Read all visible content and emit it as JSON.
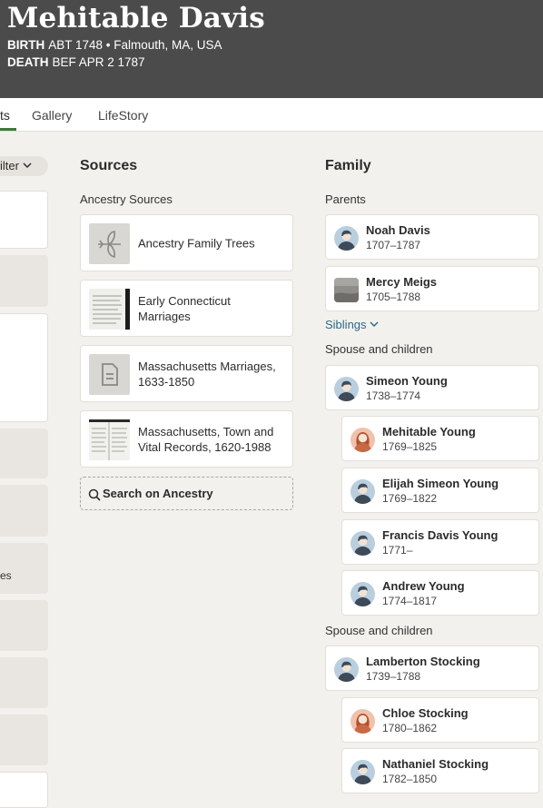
{
  "person": {
    "name": "Mehitable Davis",
    "birth_label": "BIRTH",
    "birth_value": "ABT 1748 • Falmouth, MA, USA",
    "death_label": "DEATH",
    "death_value": "BEF APR 2 1787"
  },
  "tabs": [
    {
      "label": "ts"
    },
    {
      "label": "Gallery"
    },
    {
      "label": "LifeStory"
    }
  ],
  "left": {
    "filter_label": "ilter",
    "partial_text": "es"
  },
  "sources": {
    "title": "Sources",
    "subtitle": "Ancestry Sources",
    "items": [
      {
        "label": "Ancestry Family Trees",
        "icon": "leaf-icon"
      },
      {
        "label": "Early Connecticut Marriages",
        "icon": "document-thumbnail"
      },
      {
        "label": "Massachusetts Marriages, 1633-1850",
        "icon": "document-icon"
      },
      {
        "label": "Massachusetts, Town and Vital Records, 1620-1988",
        "icon": "document-thumbnail"
      }
    ],
    "search_label": "Search on Ancestry"
  },
  "family": {
    "title": "Family",
    "parents_label": "Parents",
    "parents": [
      {
        "name": "Noah Davis",
        "dates": "1707–1787",
        "avatar": "male"
      },
      {
        "name": "Mercy Meigs",
        "dates": "1705–1788",
        "avatar": "photo"
      }
    ],
    "siblings_label": "Siblings",
    "spouse_label_1": "Spouse and children",
    "spouse_1": {
      "name": "Simeon Young",
      "dates": "1738–1774",
      "avatar": "male"
    },
    "children_1": [
      {
        "name": "Mehitable Young",
        "dates": "1769–1825",
        "avatar": "female"
      },
      {
        "name": "Elijah Simeon Young",
        "dates": "1769–1822",
        "avatar": "male"
      },
      {
        "name": "Francis Davis Young",
        "dates": "1771–",
        "avatar": "male"
      },
      {
        "name": "Andrew Young",
        "dates": "1774–1817",
        "avatar": "male"
      }
    ],
    "spouse_label_2": "Spouse and children",
    "spouse_2": {
      "name": "Lamberton Stocking",
      "dates": "1739–1788",
      "avatar": "male"
    },
    "children_2": [
      {
        "name": "Chloe Stocking",
        "dates": "1780–1862",
        "avatar": "female"
      },
      {
        "name": "Nathaniel Stocking",
        "dates": "1782–1850",
        "avatar": "male"
      }
    ]
  },
  "colors": {
    "header_bg": "#4b4b4b",
    "accent_green": "#3c7a3a",
    "link_blue": "#2a6b8a",
    "male_avatar_bg": "#b9cede",
    "female_avatar_bg": "#f0c2ad"
  }
}
